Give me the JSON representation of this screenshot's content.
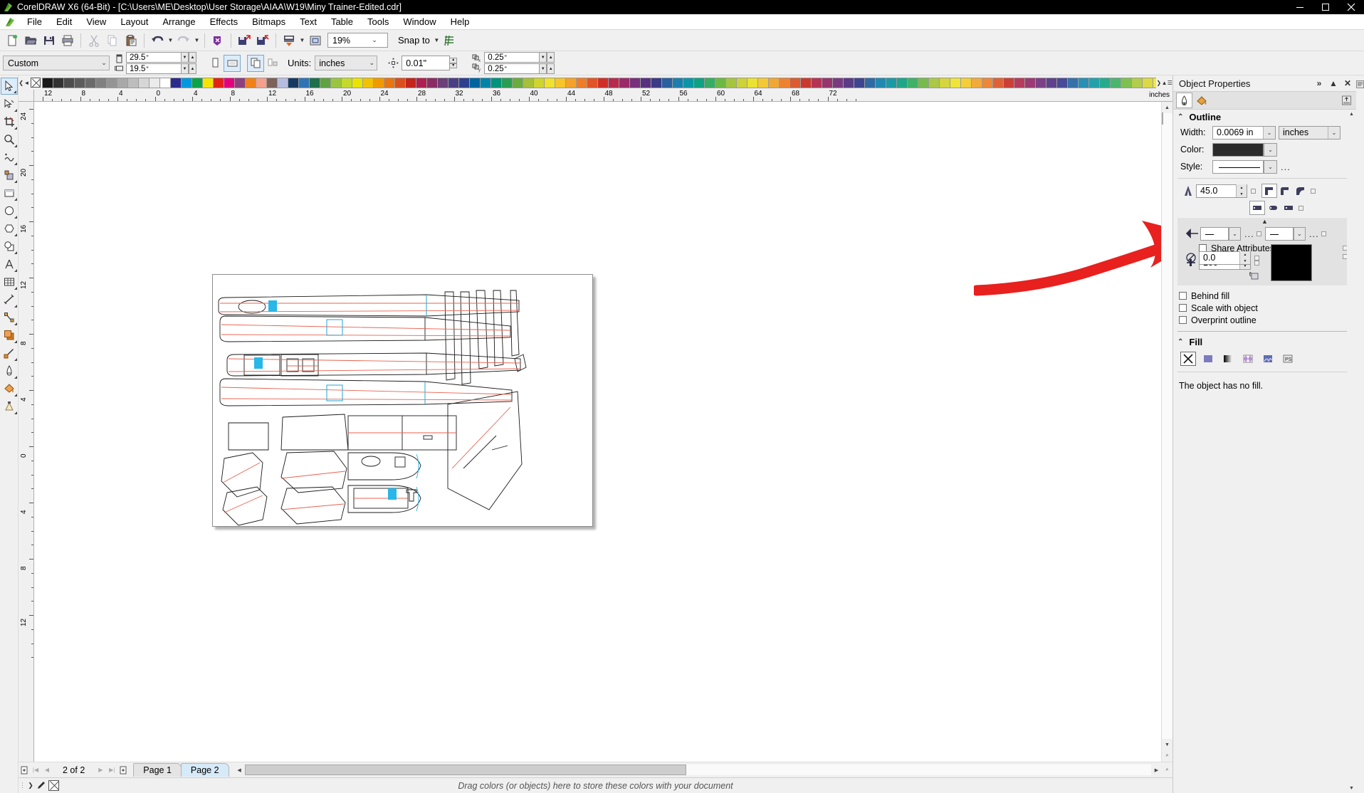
{
  "window": {
    "title": "CorelDRAW X6 (64-Bit) - [C:\\Users\\ME\\Desktop\\User Storage\\AIAA\\W19\\Miny Trainer-Edited.cdr]",
    "app_icon": "coreldraw-balloon-icon",
    "minimize": "minimize-icon",
    "maximize": "maximize-icon",
    "close": "close-icon"
  },
  "menu": {
    "items": [
      {
        "label": "File",
        "accel": "F"
      },
      {
        "label": "Edit",
        "accel": "E"
      },
      {
        "label": "View",
        "accel": "V"
      },
      {
        "label": "Layout",
        "accel": "L"
      },
      {
        "label": "Arrange",
        "accel": "A"
      },
      {
        "label": "Effects",
        "accel": "c"
      },
      {
        "label": "Bitmaps",
        "accel": "B"
      },
      {
        "label": "Text",
        "accel": "x"
      },
      {
        "label": "Table",
        "accel": "T"
      },
      {
        "label": "Tools",
        "accel": "o"
      },
      {
        "label": "Window",
        "accel": "W"
      },
      {
        "label": "Help",
        "accel": "H"
      }
    ]
  },
  "toolbar": {
    "buttons": [
      "new-document-icon",
      "open-document-icon",
      "save-icon",
      "print-icon",
      "cut-icon",
      "copy-icon",
      "paste-icon",
      "undo-icon",
      "redo-icon",
      "search-content-icon",
      "import-icon",
      "export-icon",
      "publish-to-pdf-icon",
      "application-launcher-icon"
    ],
    "zoom_level": "19%",
    "snap_to_label": "Snap to",
    "options_icon": "options-icon"
  },
  "propertybar": {
    "page_preset": "Custom",
    "page_width": "29.5",
    "page_height": "19.5",
    "unit_mark": "\"",
    "orientation_portrait": "portrait-icon",
    "orientation_landscape": "landscape-icon",
    "all_pages_icon": "all-pages-icon",
    "current_page_icon": "current-page-only-icon",
    "units_label": "Units:",
    "units_value": "inches",
    "nudge_icon": "nudge-offset-icon",
    "nudge_value": "0.01",
    "duplicate_x_icon": "duplicate-distance-x-icon",
    "duplicate_x": "0.25",
    "duplicate_y_icon": "duplicate-distance-y-icon",
    "duplicate_y": "0.25"
  },
  "toolbox": {
    "tools": [
      {
        "name": "pick-tool-icon",
        "active": true
      },
      {
        "name": "shape-tool-icon",
        "active": false
      },
      {
        "name": "crop-tool-icon",
        "active": false
      },
      {
        "name": "zoom-tool-icon",
        "active": false
      },
      {
        "name": "freehand-tool-icon",
        "active": false
      },
      {
        "name": "smart-fill-tool-icon",
        "active": false
      },
      {
        "name": "rectangle-tool-icon",
        "active": false
      },
      {
        "name": "ellipse-tool-icon",
        "active": false
      },
      {
        "name": "polygon-tool-icon",
        "active": false
      },
      {
        "name": "basic-shapes-tool-icon",
        "active": false
      },
      {
        "name": "text-tool-icon",
        "active": false
      },
      {
        "name": "table-tool-icon",
        "active": false
      },
      {
        "name": "dimension-tool-icon",
        "active": false
      },
      {
        "name": "connector-tool-icon",
        "active": false
      },
      {
        "name": "drop-shadow-tool-icon",
        "active": false
      },
      {
        "name": "color-eyedropper-tool-icon",
        "active": false
      },
      {
        "name": "outline-pen-tool-icon",
        "active": false
      },
      {
        "name": "fill-tool-icon",
        "active": false
      },
      {
        "name": "interactive-fill-tool-icon",
        "active": false
      }
    ]
  },
  "palette": {
    "no_color_icon": "no-color-swatch",
    "colors": [
      "#1a1a1a",
      "#333333",
      "#4d4d4d",
      "#5c5c5c",
      "#6b6b6b",
      "#808080",
      "#949494",
      "#a8a8a8",
      "#bdbdbd",
      "#d6d6d6",
      "#ebebeb",
      "#ffffff",
      "#2b2b8f",
      "#0099dd",
      "#0aa34a",
      "#f5e400",
      "#e2231a",
      "#e5007d",
      "#8e3f7e",
      "#f08019",
      "#f4a08a",
      "#7d6259",
      "#b6bde0",
      "#173a63",
      "#2e74b5",
      "#1f6f4a",
      "#5fa341",
      "#9ac63f",
      "#c5d92d",
      "#e8e400",
      "#f2c200",
      "#f09a00",
      "#e87511",
      "#d94f1e",
      "#c3241b",
      "#b01f4f",
      "#8a2d63",
      "#6b3f77",
      "#4a3f84",
      "#2d3f8f",
      "#00649f",
      "#0084a8",
      "#00927a",
      "#2a9d55",
      "#69ad3c",
      "#a6c03a",
      "#cfd430",
      "#f0e22a",
      "#f5c52a",
      "#f4a22a",
      "#ef7d27",
      "#e15427",
      "#cf2f28",
      "#b92a4f",
      "#9a2b68",
      "#78307a",
      "#56327f",
      "#3a3a87",
      "#2a5fa0",
      "#1a7fae",
      "#0e95a5",
      "#0fa184",
      "#35ad63",
      "#6cb845",
      "#a3c53f",
      "#cdd238",
      "#ebe132",
      "#f3c933",
      "#f2a634",
      "#ec8231",
      "#dc5b30",
      "#c9392f",
      "#b53456",
      "#98356e",
      "#7a3a80",
      "#5a3c86",
      "#3e4490",
      "#2f6aa4",
      "#2288b0",
      "#1b9aa6",
      "#1ea688",
      "#41b168",
      "#76bb4c",
      "#abc846",
      "#d4d53f",
      "#eee43a",
      "#f4cd3b",
      "#f3aa3c",
      "#ed8839",
      "#dd6238",
      "#ca4037",
      "#b63b5d",
      "#9a3b74",
      "#7c4086",
      "#5f428c",
      "#454b96",
      "#3570a9",
      "#2a8eb5",
      "#24a0ab",
      "#27ab8d",
      "#4ab66d",
      "#7fc051",
      "#b2cd4b",
      "#dbda44",
      "#f2e93f",
      "#f6d240",
      "#f5af41",
      "#ef8d3e",
      "#df673d",
      "#cc453c",
      "#b84062",
      "#9c4079",
      "#7e458b",
      "#614791",
      "#4a509b",
      "#3b75ae",
      "#3093ba",
      "#2aa5b0",
      "#2db092",
      "#50bb72",
      "#85c556",
      "#b8d250",
      "#e0df49",
      "#f7ee44",
      "#f9d745",
      "#f8b446",
      "#f29243",
      "#e16c42",
      "#ce4a41",
      "#ba4567",
      "#9e457e",
      "#804a90",
      "#634c96",
      "#a37c7c",
      "#a96b6b",
      "#b55e6e",
      "#f02060",
      "#ef7a62",
      "#ee6d63",
      "#d4847c",
      "#7d5361",
      "#a04f7c",
      "#eda3c6",
      "#d49fbd",
      "#9b8a99",
      "#b2adc4",
      "#c4bcd4",
      "#d6cfe2",
      "#e8e2ef",
      "#6e6e82",
      "#8c8ca0",
      "#a2a2b5",
      "#b8b8c9",
      "#cecedd",
      "#4a5a6b",
      "#60727f",
      "#7d8d96",
      "#9aa6ad",
      "#b6c0c5",
      "#8a9a6b",
      "#a3b181",
      "#bcc79a",
      "#d5ddb8",
      "#6b7a4a",
      "#7f8f5d",
      "#9aa876",
      "#b5c095",
      "#cfd7b4"
    ]
  },
  "ruler": {
    "units": "inches",
    "h_labels": [
      "12",
      "8",
      "4",
      "0",
      "4",
      "8",
      "12",
      "16",
      "20",
      "24",
      "28",
      "32",
      "36",
      "40",
      "44",
      "48",
      "52",
      "56",
      "60",
      "64",
      "68",
      "72"
    ],
    "v_labels": [
      "24",
      "20",
      "16",
      "12",
      "8",
      "4",
      "0",
      "4",
      "8",
      "12"
    ],
    "v_units": "inches"
  },
  "canvas": {
    "document_page_label": "drawing-page",
    "annotation": {
      "name": "red-arrow-annotation",
      "color": "#e8201e"
    },
    "artwork_name": "model-aircraft-parts-drawing",
    "stroke_black": "#1a1a1a",
    "stroke_red": "#e8624f",
    "stroke_cyan": "#22b3e0"
  },
  "pagebar": {
    "add_page_start_icon": "insert-page-before-icon",
    "first_icon": "first-page-icon",
    "prev_icon": "previous-page-icon",
    "count_label": "2 of 2",
    "next_icon": "next-page-icon",
    "last_icon": "last-page-icon",
    "add_page_end_icon": "insert-page-after-icon",
    "tabs": [
      {
        "label": "Page 1",
        "active": false
      },
      {
        "label": "Page 2",
        "active": true
      }
    ]
  },
  "statusbar": {
    "eyedropper_icon": "eyedropper-icon",
    "no_fill_icon": "no-fill-swatch",
    "message": "Drag colors (or objects) here to store these colors with your document"
  },
  "docker": {
    "title": "Object Properties",
    "expand_icon": "chevron-double-right-icon",
    "collapse_icon": "chevron-up-icon",
    "close_icon": "close-icon",
    "tabs": [
      {
        "name": "outline-tab-icon",
        "selected": true
      },
      {
        "name": "fill-tab-icon",
        "selected": false
      }
    ],
    "apply_icon": "apply-to-duplicate-icon",
    "outline": {
      "section_title": "Outline",
      "width_label": "Width:",
      "width_value": "0.0069 in",
      "width_units": "inches",
      "color_label": "Color:",
      "color_value": "#2b2b2b",
      "style_label": "Style:",
      "style_value": "solid-line",
      "more_label": "...",
      "miter_icon": "miter-limit-icon",
      "miter_value": "45.0",
      "corner_icons": [
        "corner-miter-icon",
        "corner-round-icon",
        "corner-bevel-icon"
      ],
      "cap_icons": [
        "cap-butt-icon",
        "cap-round-icon",
        "cap-square-icon"
      ],
      "arrow_icon": "arrowhead-icon",
      "start_arrow": "none-line",
      "end_arrow": "none-line",
      "share_attributes_label": "Share Attributes",
      "nib_stretch_icon": "nib-stretch-icon",
      "nib_stretch_value": "100",
      "nib_angle_icon": "nib-angle-icon",
      "nib_angle_value": "0.0",
      "preview_color": "#000000",
      "checkboxes": [
        {
          "label": "Behind fill",
          "checked": false
        },
        {
          "label": "Scale with object",
          "checked": false
        },
        {
          "label": "Overprint outline",
          "checked": false
        }
      ]
    },
    "fill": {
      "section_title": "Fill",
      "types": [
        {
          "name": "no-fill-icon",
          "selected": true
        },
        {
          "name": "uniform-fill-icon",
          "selected": false
        },
        {
          "name": "fountain-fill-icon",
          "selected": false
        },
        {
          "name": "pattern-fill-icon",
          "selected": false
        },
        {
          "name": "texture-fill-icon",
          "selected": false
        },
        {
          "name": "postscript-fill-icon",
          "selected": false
        }
      ],
      "status_text": "The object has no fill."
    }
  }
}
